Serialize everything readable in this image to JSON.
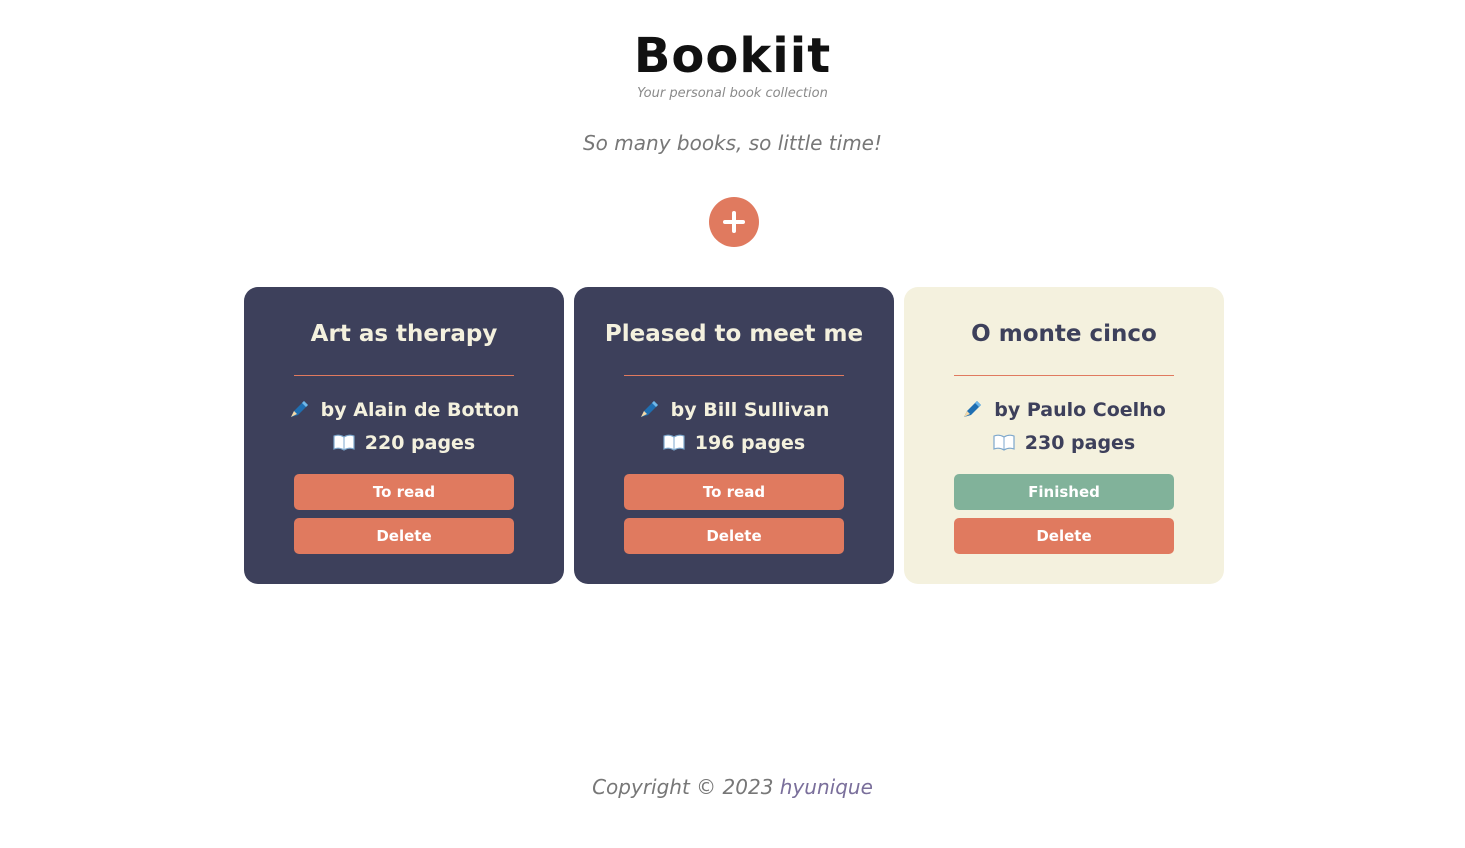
{
  "header": {
    "title": "Bookiit",
    "subtitle": "Your personal book collection"
  },
  "tagline": "So many books, so little time!",
  "add_button": {
    "icon": "plus-icon"
  },
  "books": [
    {
      "title": "Art as therapy",
      "author": "by Alain de Botton",
      "pages": "220 pages",
      "status": "To read",
      "delete": "Delete",
      "theme": "dark"
    },
    {
      "title": "Pleased to meet me",
      "author": "by Bill Sullivan",
      "pages": "196 pages",
      "status": "To read",
      "delete": "Delete",
      "theme": "dark"
    },
    {
      "title": "O monte cinco",
      "author": "by Paulo Coelho",
      "pages": "230 pages",
      "status": "Finished",
      "delete": "Delete",
      "theme": "light"
    }
  ],
  "footer": {
    "copyright": "Copyright © 2023",
    "author": "hyunique"
  },
  "colors": {
    "accent": "#e07a5f",
    "dark_card": "#3d405b",
    "light_card": "#f4f1de",
    "finished": "#81b29a"
  }
}
